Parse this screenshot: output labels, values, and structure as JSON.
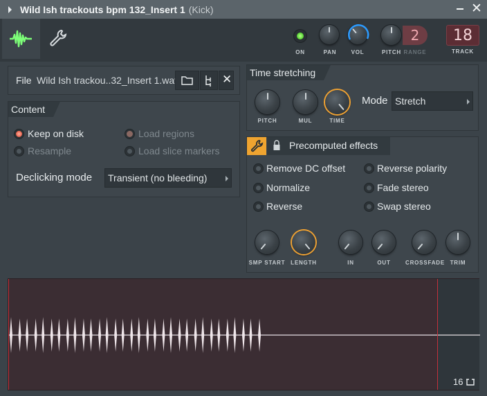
{
  "window": {
    "title": "Wild Ish trackouts bpm 132_Insert 1",
    "subtitle": "(Kick)"
  },
  "toolbar": {
    "on_label": "ON",
    "pan_label": "PAN",
    "vol_label": "VOL",
    "pitch_label": "PITCH",
    "range_label": "RANGE",
    "range_value": "2",
    "track_label": "TRACK",
    "track_value": "18",
    "on_state": true
  },
  "file": {
    "label": "File",
    "name": "Wild Ish trackou..32_Insert 1.wav"
  },
  "content": {
    "title": "Content",
    "options": [
      {
        "label": "Keep on disk",
        "selected": true,
        "enabled": true
      },
      {
        "label": "Resample",
        "selected": false,
        "enabled": false
      },
      {
        "label": "Load regions",
        "selected": true,
        "enabled": false
      },
      {
        "label": "Load slice markers",
        "selected": false,
        "enabled": false
      }
    ],
    "declicking_label": "Declicking mode",
    "declicking_value": "Transient (no bleeding)"
  },
  "time_stretching": {
    "title": "Time stretching",
    "pitch_label": "PITCH",
    "mul_label": "MUL",
    "time_label": "TIME",
    "mode_label": "Mode",
    "mode_value": "Stretch"
  },
  "precomputed": {
    "title": "Precomputed effects",
    "effects": [
      {
        "label": "Remove DC offset"
      },
      {
        "label": "Reverse polarity"
      },
      {
        "label": "Normalize"
      },
      {
        "label": "Fade stereo"
      },
      {
        "label": "Reverse"
      },
      {
        "label": "Swap stereo"
      }
    ],
    "knobs": {
      "smp_start": "SMP START",
      "length": "LENGTH",
      "in": "IN",
      "out": "OUT",
      "crossfade": "CROSSFADE",
      "trim": "TRIM"
    }
  },
  "waveform": {
    "beats": "16",
    "hits": 32
  },
  "colors": {
    "accent_orange": "#f0a232",
    "accent_green": "#5fd83b",
    "waveform_bg": "#3b2d33",
    "marker_red": "#c5303a"
  }
}
